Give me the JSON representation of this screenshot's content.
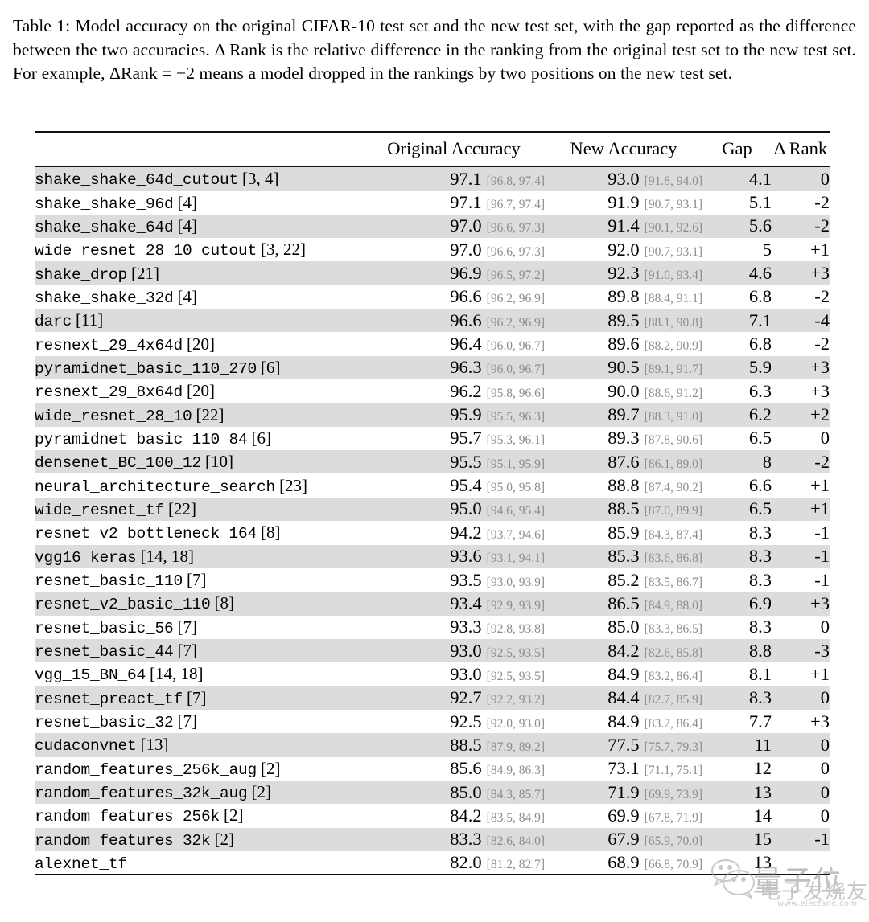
{
  "caption": {
    "text": "Table 1: Model accuracy on the original CIFAR-10 test set and the new test set, with the gap reported as the difference between the two accuracies. Δ Rank is the relative difference in the ranking from the original test set to the new test set. For example, ΔRank = −2 means a model dropped in the rankings by two positions on the new test set."
  },
  "table": {
    "headers": {
      "model": "",
      "original_accuracy": "Original Accuracy",
      "new_accuracy": "New Accuracy",
      "gap": "Gap",
      "delta_rank": "Δ Rank"
    },
    "colors": {
      "row_shade": "#dcdcdc",
      "ci_text": "#8c8c8c",
      "rule": "#111111"
    },
    "rows": [
      {
        "model": "shake_shake_64d_cutout",
        "ref": "[3, 4]",
        "orig": "97.1",
        "orig_ci": "[96.8, 97.4]",
        "new": "93.0",
        "new_ci": "[91.8, 94.0]",
        "gap": "4.1",
        "rank": "0"
      },
      {
        "model": "shake_shake_96d",
        "ref": "[4]",
        "orig": "97.1",
        "orig_ci": "[96.7, 97.4]",
        "new": "91.9",
        "new_ci": "[90.7, 93.1]",
        "gap": "5.1",
        "rank": "-2"
      },
      {
        "model": "shake_shake_64d",
        "ref": "[4]",
        "orig": "97.0",
        "orig_ci": "[96.6, 97.3]",
        "new": "91.4",
        "new_ci": "[90.1, 92.6]",
        "gap": "5.6",
        "rank": "-2"
      },
      {
        "model": "wide_resnet_28_10_cutout",
        "ref": "[3, 22]",
        "orig": "97.0",
        "orig_ci": "[96.6, 97.3]",
        "new": "92.0",
        "new_ci": "[90.7, 93.1]",
        "gap": "5",
        "rank": "+1"
      },
      {
        "model": "shake_drop",
        "ref": "[21]",
        "orig": "96.9",
        "orig_ci": "[96.5, 97.2]",
        "new": "92.3",
        "new_ci": "[91.0, 93.4]",
        "gap": "4.6",
        "rank": "+3"
      },
      {
        "model": "shake_shake_32d",
        "ref": "[4]",
        "orig": "96.6",
        "orig_ci": "[96.2, 96.9]",
        "new": "89.8",
        "new_ci": "[88.4, 91.1]",
        "gap": "6.8",
        "rank": "-2"
      },
      {
        "model": "darc",
        "ref": "[11]",
        "orig": "96.6",
        "orig_ci": "[96.2, 96.9]",
        "new": "89.5",
        "new_ci": "[88.1, 90.8]",
        "gap": "7.1",
        "rank": "-4"
      },
      {
        "model": "resnext_29_4x64d",
        "ref": "[20]",
        "orig": "96.4",
        "orig_ci": "[96.0, 96.7]",
        "new": "89.6",
        "new_ci": "[88.2, 90.9]",
        "gap": "6.8",
        "rank": "-2"
      },
      {
        "model": "pyramidnet_basic_110_270",
        "ref": "[6]",
        "orig": "96.3",
        "orig_ci": "[96.0, 96.7]",
        "new": "90.5",
        "new_ci": "[89.1, 91.7]",
        "gap": "5.9",
        "rank": "+3"
      },
      {
        "model": "resnext_29_8x64d",
        "ref": "[20]",
        "orig": "96.2",
        "orig_ci": "[95.8, 96.6]",
        "new": "90.0",
        "new_ci": "[88.6, 91.2]",
        "gap": "6.3",
        "rank": "+3"
      },
      {
        "model": "wide_resnet_28_10",
        "ref": "[22]",
        "orig": "95.9",
        "orig_ci": "[95.5, 96.3]",
        "new": "89.7",
        "new_ci": "[88.3, 91.0]",
        "gap": "6.2",
        "rank": "+2"
      },
      {
        "model": "pyramidnet_basic_110_84",
        "ref": "[6]",
        "orig": "95.7",
        "orig_ci": "[95.3, 96.1]",
        "new": "89.3",
        "new_ci": "[87.8, 90.6]",
        "gap": "6.5",
        "rank": "0"
      },
      {
        "model": "densenet_BC_100_12",
        "ref": "[10]",
        "orig": "95.5",
        "orig_ci": "[95.1, 95.9]",
        "new": "87.6",
        "new_ci": "[86.1, 89.0]",
        "gap": "8",
        "rank": "-2"
      },
      {
        "model": "neural_architecture_search",
        "ref": "[23]",
        "orig": "95.4",
        "orig_ci": "[95.0, 95.8]",
        "new": "88.8",
        "new_ci": "[87.4, 90.2]",
        "gap": "6.6",
        "rank": "+1"
      },
      {
        "model": "wide_resnet_tf",
        "ref": "[22]",
        "orig": "95.0",
        "orig_ci": "[94.6, 95.4]",
        "new": "88.5",
        "new_ci": "[87.0, 89.9]",
        "gap": "6.5",
        "rank": "+1"
      },
      {
        "model": "resnet_v2_bottleneck_164",
        "ref": "[8]",
        "orig": "94.2",
        "orig_ci": "[93.7, 94.6]",
        "new": "85.9",
        "new_ci": "[84.3, 87.4]",
        "gap": "8.3",
        "rank": "-1"
      },
      {
        "model": "vgg16_keras",
        "ref": "[14, 18]",
        "orig": "93.6",
        "orig_ci": "[93.1, 94.1]",
        "new": "85.3",
        "new_ci": "[83.6, 86.8]",
        "gap": "8.3",
        "rank": "-1"
      },
      {
        "model": "resnet_basic_110",
        "ref": "[7]",
        "orig": "93.5",
        "orig_ci": "[93.0, 93.9]",
        "new": "85.2",
        "new_ci": "[83.5, 86.7]",
        "gap": "8.3",
        "rank": "-1"
      },
      {
        "model": "resnet_v2_basic_110",
        "ref": "[8]",
        "orig": "93.4",
        "orig_ci": "[92.9, 93.9]",
        "new": "86.5",
        "new_ci": "[84.9, 88.0]",
        "gap": "6.9",
        "rank": "+3"
      },
      {
        "model": "resnet_basic_56",
        "ref": "[7]",
        "orig": "93.3",
        "orig_ci": "[92.8, 93.8]",
        "new": "85.0",
        "new_ci": "[83.3, 86.5]",
        "gap": "8.3",
        "rank": "0"
      },
      {
        "model": "resnet_basic_44",
        "ref": "[7]",
        "orig": "93.0",
        "orig_ci": "[92.5, 93.5]",
        "new": "84.2",
        "new_ci": "[82.6, 85.8]",
        "gap": "8.8",
        "rank": "-3"
      },
      {
        "model": "vgg_15_BN_64",
        "ref": "[14, 18]",
        "orig": "93.0",
        "orig_ci": "[92.5, 93.5]",
        "new": "84.9",
        "new_ci": "[83.2, 86.4]",
        "gap": "8.1",
        "rank": "+1"
      },
      {
        "model": "resnet_preact_tf",
        "ref": "[7]",
        "orig": "92.7",
        "orig_ci": "[92.2, 93.2]",
        "new": "84.4",
        "new_ci": "[82.7, 85.9]",
        "gap": "8.3",
        "rank": "0"
      },
      {
        "model": "resnet_basic_32",
        "ref": "[7]",
        "orig": "92.5",
        "orig_ci": "[92.0, 93.0]",
        "new": "84.9",
        "new_ci": "[83.2, 86.4]",
        "gap": "7.7",
        "rank": "+3"
      },
      {
        "model": "cudaconvnet",
        "ref": "[13]",
        "orig": "88.5",
        "orig_ci": "[87.9, 89.2]",
        "new": "77.5",
        "new_ci": "[75.7, 79.3]",
        "gap": "11",
        "rank": "0"
      },
      {
        "model": "random_features_256k_aug",
        "ref": "[2]",
        "orig": "85.6",
        "orig_ci": "[84.9, 86.3]",
        "new": "73.1",
        "new_ci": "[71.1, 75.1]",
        "gap": "12",
        "rank": "0"
      },
      {
        "model": "random_features_32k_aug",
        "ref": "[2]",
        "orig": "85.0",
        "orig_ci": "[84.3, 85.7]",
        "new": "71.9",
        "new_ci": "[69.9, 73.9]",
        "gap": "13",
        "rank": "0"
      },
      {
        "model": "random_features_256k",
        "ref": "[2]",
        "orig": "84.2",
        "orig_ci": "[83.5, 84.9]",
        "new": "69.9",
        "new_ci": "[67.8, 71.9]",
        "gap": "14",
        "rank": "0"
      },
      {
        "model": "random_features_32k",
        "ref": "[2]",
        "orig": "83.3",
        "orig_ci": "[82.6, 84.0]",
        "new": "67.9",
        "new_ci": "[65.9, 70.0]",
        "gap": "15",
        "rank": "-1"
      },
      {
        "model": "alexnet_tf",
        "ref": "",
        "orig": "82.0",
        "orig_ci": "[81.2, 82.7]",
        "new": "68.9",
        "new_ci": "[66.8, 70.9]",
        "gap": "13",
        "rank": ""
      }
    ]
  },
  "watermark": {
    "brand_cn": "量子位",
    "brand_cn2": "电子发烧友",
    "url": "www.elecfans.com"
  }
}
